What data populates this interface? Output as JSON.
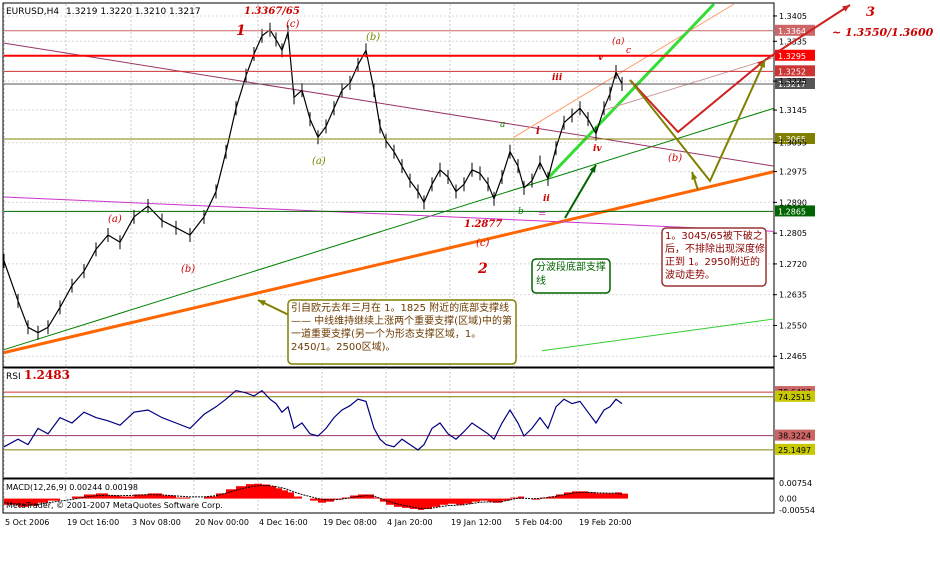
{
  "chart_data": {
    "type": "line",
    "title": "EURUSD,H4",
    "ohlc_readout": "1.3219 1.3220 1.3210 1.3217",
    "copyright": "MetaTrader, © 2001-2007 MetaQuotes Software Corp.",
    "x_tick_labels": [
      "5 Oct 2006",
      "19 Oct 16:00",
      "3 Nov 08:00",
      "20 Nov 00:00",
      "4 Dec 16:00",
      "19 Dec 08:00",
      "4 Jan 20:00",
      "19 Jan 12:00",
      "5 Feb 04:00",
      "19 Feb 20:00"
    ],
    "price_panel": {
      "ylim": [
        1.2438,
        1.3438
      ],
      "y_ticks": [
        1.3405,
        1.3335,
        1.3225,
        1.3145,
        1.3055,
        1.2975,
        1.289,
        1.2805,
        1.272,
        1.2635,
        1.255,
        1.2465
      ],
      "y_tick_labels": [
        "1.3405",
        "1.3335",
        "1.3225",
        "1.3145",
        "1.3055",
        "1.2975",
        "1.2890",
        "1.2805",
        "1.2720",
        "1.2635",
        "1.2550",
        "1.2465"
      ],
      "x": [
        0,
        14,
        24,
        34,
        44,
        56,
        68,
        80,
        92,
        104,
        116,
        130,
        144,
        158,
        172,
        186,
        200,
        212,
        222,
        232,
        242,
        250,
        258,
        266,
        272,
        278,
        284,
        290,
        298,
        306,
        314,
        322,
        330,
        338,
        346,
        354,
        362,
        370,
        376,
        382,
        390,
        398,
        406,
        414,
        420,
        428,
        436,
        444,
        452,
        460,
        468,
        476,
        484,
        490,
        498,
        506,
        514,
        520,
        528,
        536,
        544,
        552,
        560,
        568,
        576,
        584,
        592,
        600,
        606,
        612,
        618
      ],
      "close": [
        1.2728,
        1.2618,
        1.2545,
        1.253,
        1.2545,
        1.26,
        1.266,
        1.27,
        1.276,
        1.28,
        1.278,
        1.285,
        1.288,
        1.284,
        1.282,
        1.28,
        1.285,
        1.292,
        1.303,
        1.315,
        1.324,
        1.33,
        1.335,
        1.3367,
        1.334,
        1.331,
        1.336,
        1.318,
        1.32,
        1.312,
        1.307,
        1.31,
        1.315,
        1.32,
        1.322,
        1.327,
        1.331,
        1.32,
        1.31,
        1.306,
        1.303,
        1.299,
        1.295,
        1.292,
        1.289,
        1.294,
        1.298,
        1.296,
        1.292,
        1.294,
        1.298,
        1.297,
        1.294,
        1.29,
        1.296,
        1.303,
        1.299,
        1.293,
        1.295,
        1.3,
        1.2955,
        1.304,
        1.311,
        1.313,
        1.315,
        1.312,
        1.308,
        1.315,
        1.319,
        1.325,
        1.3217
      ],
      "horizontal_levels": [
        {
          "label": "1.3364",
          "price": 1.3364,
          "color": "#cc6666"
        },
        {
          "label": "1.3295",
          "price": 1.3295,
          "color": "#ff0000"
        },
        {
          "label": "1.3252",
          "price": 1.3252,
          "color": "#cc3333"
        },
        {
          "label": "1.3217",
          "price": 1.3217,
          "color": "#555555"
        },
        {
          "label": "1.3065",
          "price": 1.3065,
          "color": "#808000"
        },
        {
          "label": "1.2865",
          "price": 1.2865,
          "color": "#006400"
        }
      ]
    },
    "wave_labels": [
      "1",
      "1.3367/65",
      "(c)",
      "(b)",
      "(a)",
      "(a)",
      "(b)",
      "1.2877",
      "(c)",
      "2",
      "a",
      "b",
      "c",
      "i",
      "ii",
      "iii",
      "iv",
      "v",
      "(a)",
      "(b)",
      "3",
      "~ 1.3550/1.3600",
      "="
    ],
    "callouts": {
      "support_line_note": "引自欧元去年三月在 1。1825 附近的底部支撑线 —— 中线维持继续上涨两个重要支撑(区域)中的第一道重要支撑(另一个为形态支撑区域，1。2450/1。2500区域)。",
      "wave_support_note": "分波段底部支撑线",
      "break_note": "1。3045/65被下破之后，不排除出现深度修正到 1。2950附近的波动走势。"
    },
    "low_label": "1.2483",
    "rsi_panel": {
      "label": "RSI",
      "ylim": [
        0,
        100
      ],
      "levels": [
        {
          "label": "78.6407",
          "value": 78.64
        },
        {
          "label": "74.2515",
          "value": 74.25
        },
        {
          "label": "38.3224",
          "value": 38.32
        },
        {
          "label": "25.1497",
          "value": 25.15
        }
      ],
      "values": [
        28,
        35,
        30,
        45,
        40,
        55,
        50,
        60,
        55,
        52,
        48,
        60,
        62,
        55,
        50,
        45,
        58,
        65,
        72,
        80,
        78,
        75,
        80,
        72,
        68,
        60,
        65,
        45,
        50,
        40,
        38,
        45,
        55,
        62,
        66,
        72,
        70,
        45,
        35,
        30,
        28,
        35,
        30,
        25,
        30,
        45,
        50,
        40,
        35,
        42,
        50,
        45,
        40,
        35,
        50,
        62,
        50,
        38,
        45,
        55,
        45,
        65,
        72,
        68,
        70,
        60,
        50,
        62,
        65,
        72,
        68
      ]
    },
    "macd_panel": {
      "label": "MACD(12,26,9) 0.00244 0.00198",
      "ylim": [
        -0.0065,
        0.009
      ],
      "y_tick_labels": [
        "0.00754",
        "0.00",
        "-0.00554"
      ],
      "histogram": [
        -0.003,
        -0.004,
        -0.0035,
        -0.002,
        -0.001,
        0.0,
        0.001,
        0.002,
        0.0025,
        0.0015,
        0.001,
        0.002,
        0.0025,
        0.0015,
        0.0005,
        0.0,
        0.001,
        0.0025,
        0.0045,
        0.006,
        0.007,
        0.0072,
        0.0068,
        0.006,
        0.005,
        0.004,
        0.003,
        0.001,
        0.0,
        -0.001,
        -0.002,
        -0.0015,
        -0.0005,
        0.0005,
        0.0015,
        0.002,
        0.002,
        0.0005,
        -0.0015,
        -0.003,
        -0.004,
        -0.0045,
        -0.005,
        -0.0055,
        -0.005,
        -0.004,
        -0.003,
        -0.0025,
        -0.003,
        -0.0025,
        -0.0015,
        -0.001,
        -0.0015,
        -0.002,
        -0.001,
        0.0005,
        0.001,
        0.0,
        -0.0005,
        0.0005,
        0.001,
        0.002,
        0.003,
        0.0035,
        0.0035,
        0.003,
        0.0025,
        0.0025,
        0.0025,
        0.003,
        0.0024
      ],
      "signal": [
        -0.002,
        -0.0028,
        -0.0032,
        -0.0028,
        -0.002,
        -0.0012,
        -0.0004,
        0.0006,
        0.0014,
        0.0016,
        0.0014,
        0.0016,
        0.0019,
        0.0018,
        0.0013,
        0.0008,
        0.0008,
        0.0014,
        0.0026,
        0.004,
        0.0052,
        0.006,
        0.0064,
        0.0062,
        0.0058,
        0.0052,
        0.0044,
        0.0032,
        0.002,
        0.001,
        0.0,
        -0.0006,
        -0.0006,
        -0.0002,
        0.0004,
        0.001,
        0.0014,
        0.0012,
        0.0002,
        -0.001,
        -0.0022,
        -0.0031,
        -0.0039,
        -0.0046,
        -0.0048,
        -0.0046,
        -0.004,
        -0.0034,
        -0.0032,
        -0.003,
        -0.0024,
        -0.0018,
        -0.0016,
        -0.0017,
        -0.0014,
        -0.0006,
        0.0002,
        0.0002,
        -0.0001,
        0.0001,
        0.0005,
        0.0011,
        0.0019,
        0.0026,
        0.003,
        0.003,
        0.0028,
        0.0027,
        0.0026,
        0.0027,
        0.002
      ]
    }
  }
}
